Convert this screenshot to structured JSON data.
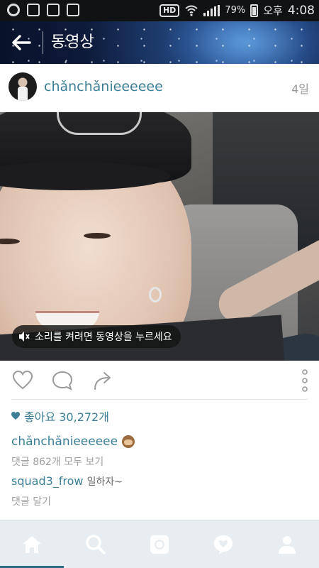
{
  "status_bar": {
    "left_icons": [
      "g-app-icon",
      "news-icon",
      "download-icon",
      "screenshot-icon"
    ],
    "hd": "HD",
    "battery": "79%",
    "ampm": "오후",
    "time": "4:08"
  },
  "header": {
    "back_icon": "arrow-left-icon",
    "title": "동영상"
  },
  "post": {
    "username": "chǎnchǎnieeeeee",
    "time_ago": "4일",
    "sound_hint": "소리를 켜려면 동영상을 누르세요",
    "likes_label": "좋아요 30,272개",
    "caption_user": "chǎnchǎnieeeeee",
    "view_all_comments": "댓글 862개 모두 보기",
    "comment": {
      "user": "squad3_frow",
      "text": "일하자~"
    },
    "add_comment": "댓글 달기"
  },
  "actions": [
    "heart-icon",
    "comment-icon",
    "share-icon",
    "more-vertical-icon"
  ],
  "bottom_nav": {
    "items": [
      "home-icon",
      "search-icon",
      "camera-icon",
      "activity-heart-icon",
      "profile-icon"
    ],
    "active_index": 0
  },
  "colors": {
    "accent": "#3c7f97",
    "nav_bg": "#e7edf0",
    "nav_active": "#2e6c84"
  }
}
